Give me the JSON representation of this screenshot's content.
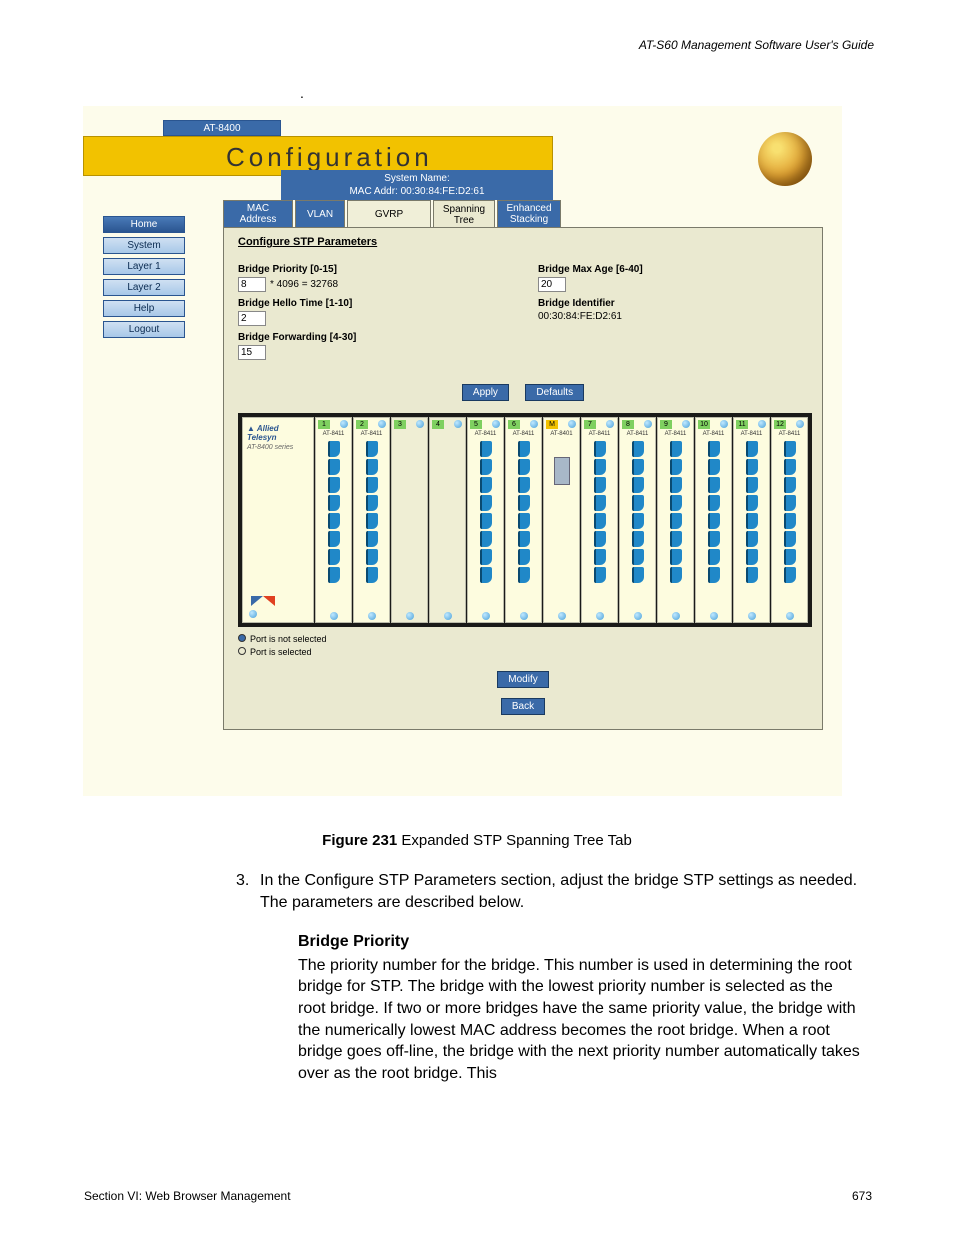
{
  "page_header": "AT-S60 Management Software User's Guide",
  "dot": ".",
  "ui": {
    "titlebar": "AT-8400",
    "config_title": "Configuration",
    "sub_banner_l1": "System Name:",
    "sub_banner_l2": "MAC Addr: 00:30:84:FE:D2:61",
    "nav": {
      "home": "Home",
      "system": "System",
      "layer1": "Layer 1",
      "layer2": "Layer 2",
      "help": "Help",
      "logout": "Logout"
    },
    "tabs": {
      "mac": "MAC Address",
      "vlan": "VLAN",
      "gvrp": "GVRP",
      "span": "Spanning\nTree",
      "enh": "Enhanced\nStacking"
    },
    "section_title": "Configure STP Parameters",
    "params": {
      "priority_label": "Bridge Priority [0-15]",
      "priority_value": "8",
      "priority_calc": "* 4096 = 32768",
      "hello_label": "Bridge Hello Time [1-10]",
      "hello_value": "2",
      "fwd_label": "Bridge Forwarding [4-30]",
      "fwd_value": "15",
      "maxage_label": "Bridge Max Age [6-40]",
      "maxage_value": "20",
      "bid_label": "Bridge Identifier",
      "bid_value": "00:30:84:FE:D2:61"
    },
    "buttons": {
      "apply": "Apply",
      "defaults": "Defaults",
      "modify": "Modify",
      "back": "Back"
    },
    "chassis": {
      "brand": "Allied Telesyn",
      "model": "AT-8400 series",
      "slots": [
        {
          "n": "1",
          "card": "AT-8411",
          "ports": 8
        },
        {
          "n": "2",
          "card": "AT-8411",
          "ports": 8
        },
        {
          "n": "3",
          "card": "",
          "ports": 0
        },
        {
          "n": "4",
          "card": "",
          "ports": 0
        },
        {
          "n": "5",
          "card": "AT-8411",
          "ports": 8
        },
        {
          "n": "6",
          "card": "AT-8411",
          "ports": 8
        },
        {
          "n": "M",
          "card": "AT-8401",
          "ports": 0,
          "mgmt": true
        },
        {
          "n": "7",
          "card": "AT-8411",
          "ports": 8
        },
        {
          "n": "8",
          "card": "AT-8411",
          "ports": 8
        },
        {
          "n": "9",
          "card": "AT-8411",
          "ports": 8
        },
        {
          "n": "10",
          "card": "AT-8411",
          "ports": 8
        },
        {
          "n": "11",
          "card": "AT-8411",
          "ports": 8
        },
        {
          "n": "12",
          "card": "AT-8411",
          "ports": 8
        }
      ]
    },
    "legend": {
      "not_selected": "Port is not selected",
      "selected": "Port is selected"
    }
  },
  "caption_bold": "Figure 231",
  "caption_rest": "  Expanded STP Spanning Tree Tab",
  "step_num": "3.",
  "step_text": "In the Configure STP Parameters section, adjust the bridge STP settings as needed. The parameters are described below.",
  "sub_heading": "Bridge Priority",
  "sub_body": "The priority number for the bridge. This number is used in determining the root bridge for STP. The bridge with the lowest priority number is selected as the root bridge. If two or more bridges have the same priority value, the bridge with the numerically lowest MAC address becomes the root bridge. When a root bridge goes off-line, the bridge with the next priority number automatically takes over as the root bridge. This",
  "footer_left": "Section VI: Web Browser Management",
  "footer_right": "673"
}
